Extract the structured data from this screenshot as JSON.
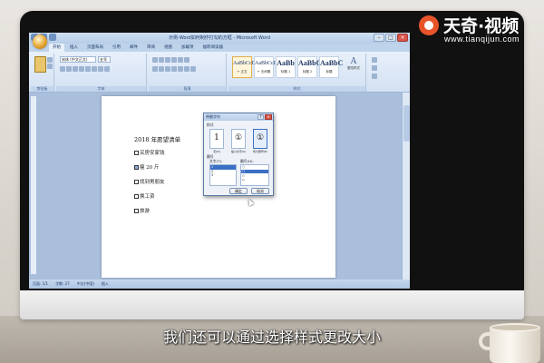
{
  "word": {
    "title": "示例-Word如何制作打勾的方框 - Microsoft Word",
    "tabs": [
      "开始",
      "插入",
      "页面布局",
      "引用",
      "邮件",
      "审阅",
      "视图",
      "加载项",
      "福昕阅读器"
    ],
    "ribbon": {
      "clipboard_label": "剪贴板",
      "font_label": "字体",
      "paragraph_label": "段落",
      "styles_label": "样式",
      "font_name": "宋体 (中文正文)",
      "font_size": "五号",
      "styles": [
        {
          "sample": "AaBbCcDd",
          "name": "↵ 正文"
        },
        {
          "sample": "AaBbCcDd",
          "name": "↵ 无间隔"
        },
        {
          "sample": "AaBb",
          "name": "标题 1"
        },
        {
          "sample": "AaBbC",
          "name": "标题 2"
        },
        {
          "sample": "AaBbC",
          "name": "标题"
        }
      ],
      "change_styles": "更改样式",
      "change_styles_glyph": "A"
    },
    "document": {
      "title": "2018 年愿望清单",
      "items": [
        "买房安家钱",
        "瘦 20 斤",
        "找到男朋友",
        "换工资",
        "旅游"
      ]
    },
    "status": [
      "页面: 1/1",
      "字数: 27",
      "中文(中国)",
      "插入"
    ]
  },
  "dialog": {
    "title": "带圈字符",
    "help": "?",
    "close": "×",
    "style_section": "样式",
    "style_options": [
      {
        "glyph": "1",
        "label": "无(N)"
      },
      {
        "glyph": "①",
        "label": "缩小文字(S)"
      },
      {
        "glyph": "①",
        "label": "增大圈号(E)"
      }
    ],
    "circle_section": "圈号",
    "text_label": "文字(T):",
    "text_list": [
      "1",
      "2",
      "3"
    ],
    "circle_label": "圈号(H):",
    "circle_list": [
      "○",
      "□",
      "△",
      "◇"
    ],
    "ok": "确定",
    "cancel": "取消"
  },
  "branding": {
    "logo_text": "天奇·视频",
    "url": "www.tianqijun.com"
  },
  "subtitle": "我们还可以通过选择样式更改大小",
  "colors": {
    "ribbon": "#e8f0fa",
    "selection": "#3a6fc4",
    "logo": "#e8542a"
  }
}
